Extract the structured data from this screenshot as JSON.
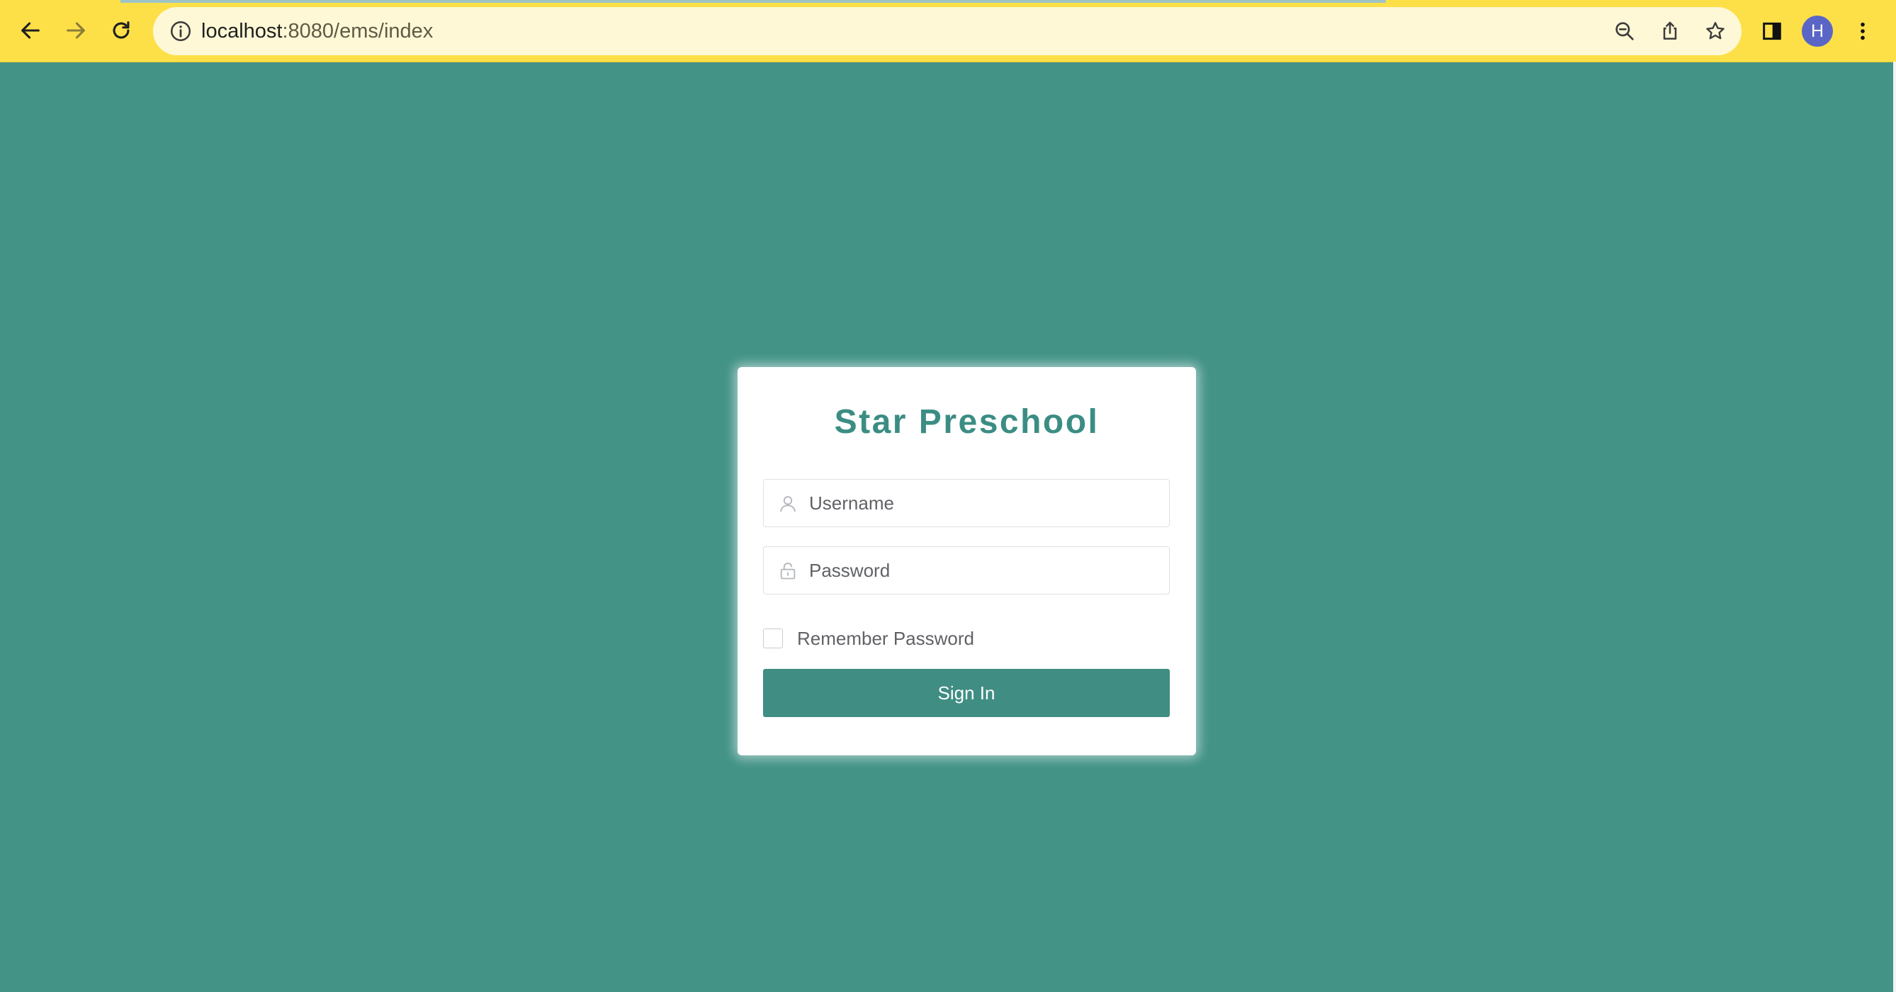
{
  "browser": {
    "url_host": "localhost",
    "url_path": ":8080/ems/index",
    "profile_initial": "H",
    "icons": {
      "back": "arrow-left-icon",
      "forward": "arrow-right-icon",
      "reload": "reload-icon",
      "site_info": "info-icon",
      "zoom": "zoom-out-icon",
      "share": "share-icon",
      "bookmark": "star-icon",
      "side_panel": "side-panel-icon",
      "menu": "kebab-menu-icon"
    },
    "colors": {
      "toolbar": "#fde047",
      "omnibox": "#fff8d6",
      "avatar": "#5a66c6"
    }
  },
  "login": {
    "title": "Star Preschool",
    "username": {
      "placeholder": "Username",
      "value": ""
    },
    "password": {
      "placeholder": "Password",
      "value": ""
    },
    "remember_label": "Remember Password",
    "remember_checked": false,
    "signin_label": "Sign In",
    "colors": {
      "background": "#439387",
      "accent": "#3f8d83"
    }
  }
}
